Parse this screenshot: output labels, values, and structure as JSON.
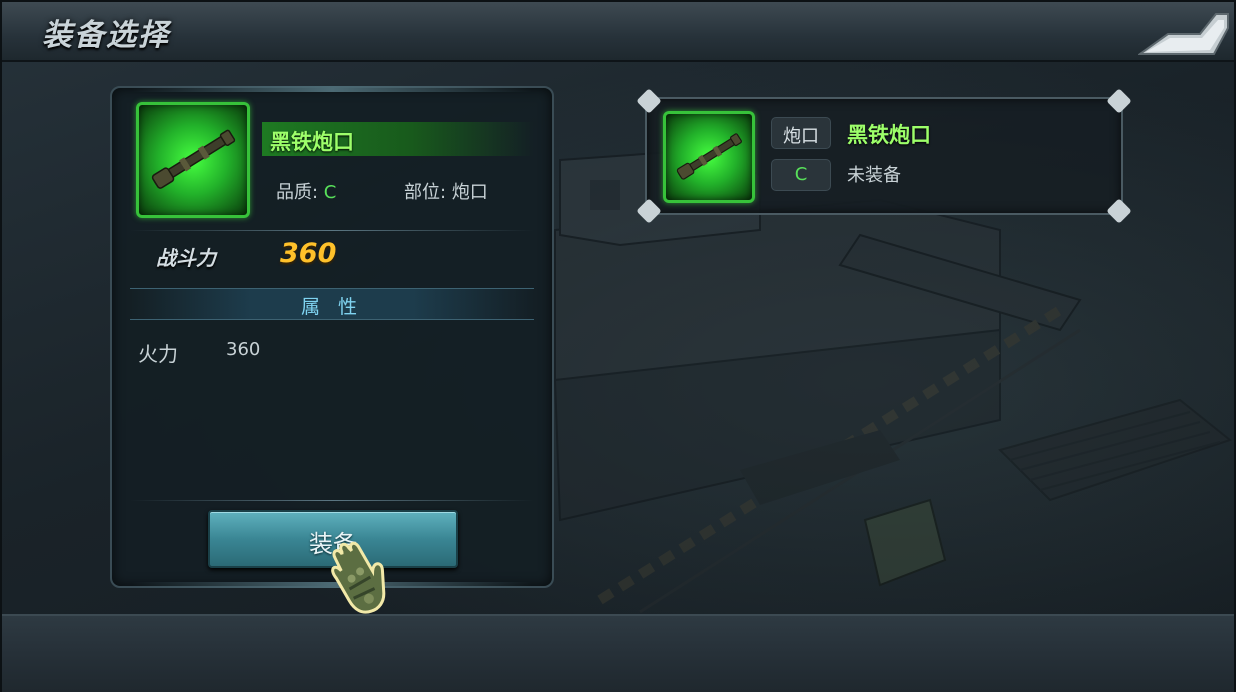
{
  "header": {
    "title": "装备选择"
  },
  "item": {
    "name": "黑铁炮口",
    "quality_label": "品质: ",
    "quality_value": "C",
    "slot_label": "部位: ",
    "slot_value": "炮口",
    "power_label": "战斗力",
    "power_value": "360",
    "attributes_title": "属 性",
    "attributes": [
      {
        "name": "火力",
        "value": "360"
      }
    ],
    "equip_button": "装备"
  },
  "current": {
    "slot_tag": "炮口",
    "item_name": "黑铁炮口",
    "quality_tag": "C",
    "status": "未装备"
  },
  "colors": {
    "item_green": "#9dff6a",
    "quality_green": "#58e05a",
    "power_gold": "#ffc12a",
    "attribute_blue": "#7fd3f0",
    "button_teal": "#3a8694"
  },
  "icons": [
    "back-arrow-icon",
    "gun-barrel-icon",
    "glove-cursor-icon"
  ]
}
